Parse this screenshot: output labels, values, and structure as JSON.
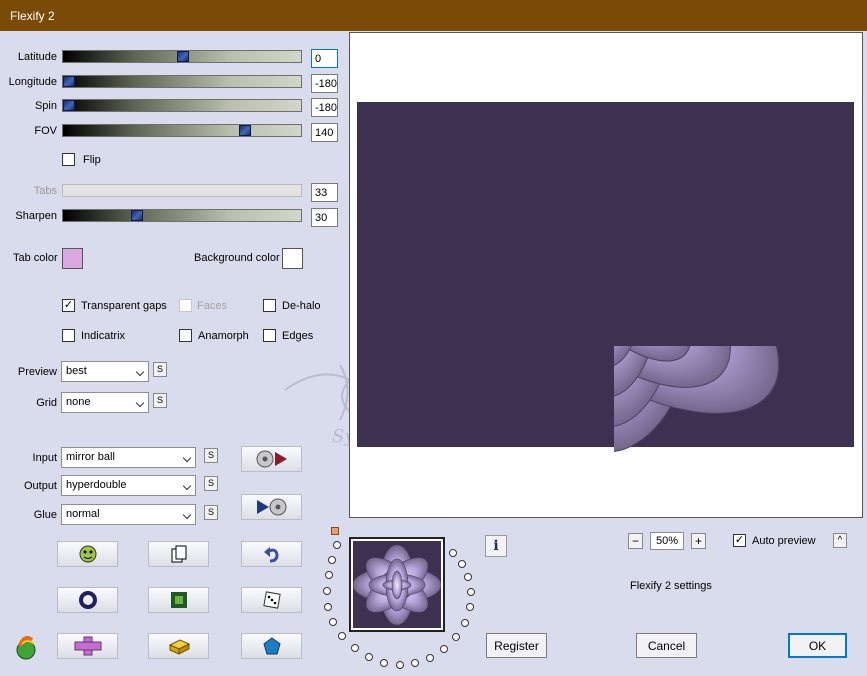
{
  "window": {
    "title": "Flexify 2"
  },
  "sliders": {
    "latitude": {
      "label": "Latitude",
      "value": "0"
    },
    "longitude": {
      "label": "Longitude",
      "value": "-180"
    },
    "spin": {
      "label": "Spin",
      "value": "-180"
    },
    "fov": {
      "label": "FOV",
      "value": "140"
    },
    "tabs": {
      "label": "Tabs",
      "value": "33"
    },
    "sharpen": {
      "label": "Sharpen",
      "value": "30"
    }
  },
  "flip": {
    "label": "Flip",
    "checked": false
  },
  "colors": {
    "tab_color_label": "Tab color",
    "tab_color": "#d9a8e0",
    "background_color_label": "Background color",
    "background_color": "#ffffff"
  },
  "options": {
    "transparent_gaps": {
      "label": "Transparent gaps",
      "checked": true
    },
    "faces": {
      "label": "Faces",
      "checked": false
    },
    "de_halo": {
      "label": "De-halo",
      "checked": false
    },
    "indicatrix": {
      "label": "Indicatrix",
      "checked": false
    },
    "anamorph": {
      "label": "Anamorph",
      "checked": false
    },
    "edges": {
      "label": "Edges",
      "checked": false
    }
  },
  "selects": {
    "preview": {
      "label": "Preview",
      "value": "best"
    },
    "grid": {
      "label": "Grid",
      "value": "none"
    },
    "input": {
      "label": "Input",
      "value": "mirror ball"
    },
    "output": {
      "label": "Output",
      "value": "hyperdouble"
    },
    "glue": {
      "label": "Glue",
      "value": "normal"
    }
  },
  "small_button_label": "S",
  "zoom": {
    "minus": "−",
    "level": "50%",
    "plus": "+"
  },
  "auto_preview": {
    "label": "Auto preview",
    "checked": true,
    "collapse": "^"
  },
  "settings_name": "Flexify 2 settings",
  "info_label": "i",
  "watermark": "Sylviane",
  "buttons": {
    "register": "Register",
    "cancel": "Cancel",
    "ok": "OK"
  }
}
